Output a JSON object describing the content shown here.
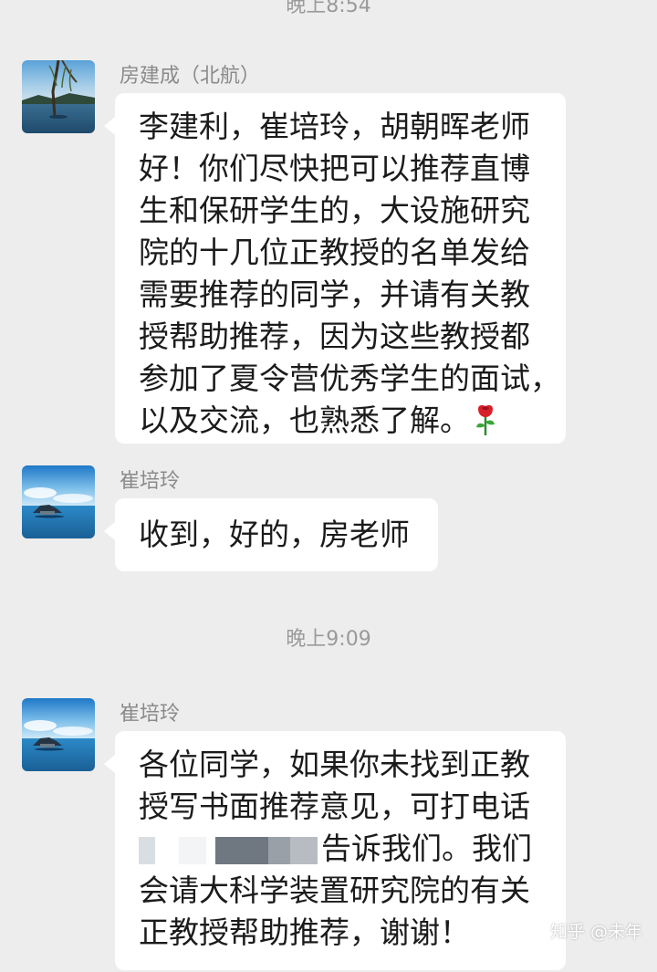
{
  "timestamps": {
    "top": "晚上8:54",
    "middle": "晚上9:09"
  },
  "messages": [
    {
      "sender": "房建成（北航）",
      "avatar": "lake-tree-avatar",
      "lines": [
        "李建利，崔培玲，胡朝晖老师",
        "好！你们尽快把可以推荐直博",
        "生和保研学生的，大设施研究",
        "院的十几位正教授的名单发给",
        "需要推荐的同学，并请有关教",
        "授帮助推荐，因为这些教授都",
        "参加了夏令营优秀学生的面试，",
        "以及交流，也熟悉了解。"
      ],
      "emoji": "rose-emoji"
    },
    {
      "sender": "崔培玲",
      "avatar": "sea-island-avatar",
      "lines": [
        "收到，好的，房老师"
      ]
    },
    {
      "sender": "崔培玲",
      "avatar": "sea-island-avatar",
      "lines": [
        "各位同学，如果你未找到正教",
        "授写书面推荐意见，可打电话",
        "告诉我们。我们",
        "会请大科学装置研究院的有关",
        "正教授帮助推荐，谢谢！"
      ],
      "redacted_phone": true
    }
  ],
  "watermark": "知乎 @未年",
  "colors": {
    "background": "#ededed",
    "bubble": "#ffffff",
    "sender_text": "#8a8a8a",
    "timestamp_text": "#9a9a9a",
    "message_text": "#1b1b1b"
  }
}
